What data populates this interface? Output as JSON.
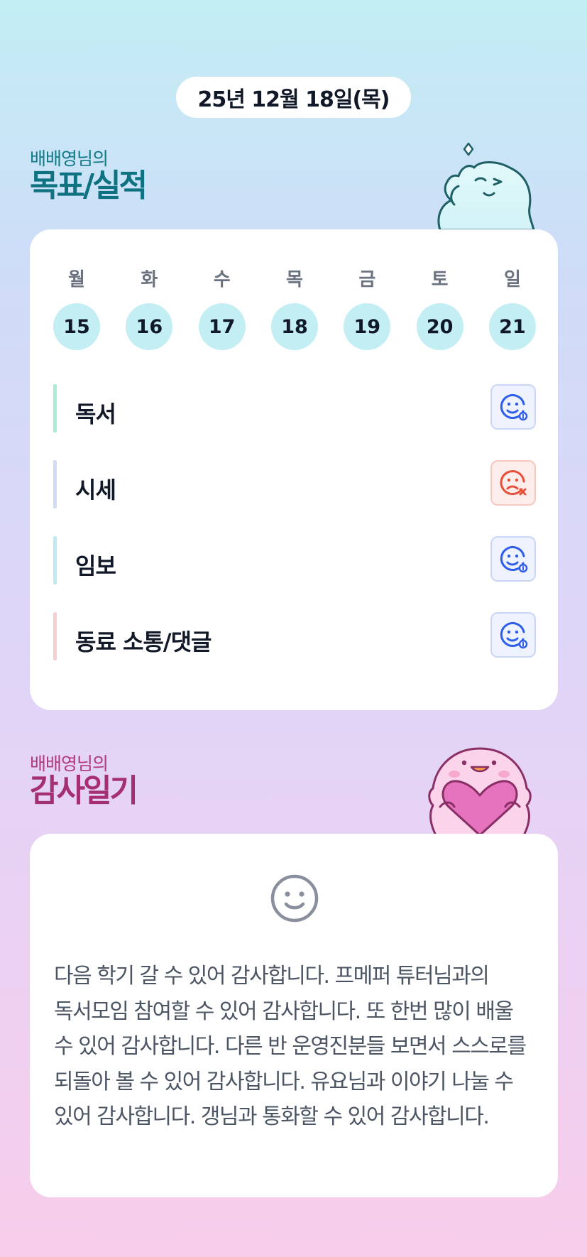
{
  "header": {
    "date": "25년 12월 18일(목)"
  },
  "goal_section": {
    "owner": "배배영님의",
    "title": "목표/실적",
    "week": [
      {
        "day": "월",
        "date": "15"
      },
      {
        "day": "화",
        "date": "16"
      },
      {
        "day": "수",
        "date": "17"
      },
      {
        "day": "목",
        "date": "18"
      },
      {
        "day": "금",
        "date": "19"
      },
      {
        "day": "토",
        "date": "20"
      },
      {
        "day": "일",
        "date": "21"
      }
    ],
    "goals": [
      {
        "label": "독서",
        "status": "done",
        "status_icon": "smile-check-icon",
        "bar_color": "#a8ecd6"
      },
      {
        "label": "시세",
        "status": "missed",
        "status_icon": "sad-x-icon",
        "bar_color": "#d3dcf6"
      },
      {
        "label": "임보",
        "status": "done",
        "status_icon": "smile-check-icon",
        "bar_color": "#bdebf1"
      },
      {
        "label": "동료 소통/댓글",
        "status": "done",
        "status_icon": "smile-check-icon",
        "bar_color": "#f9cfd2"
      }
    ]
  },
  "gratitude_section": {
    "owner": "배배영님의",
    "title": "감사일기",
    "mood_icon": "smile-face-icon",
    "text": "다음 학기 갈 수 있어 감사합니다. 프메퍼 튜터님과의 독서모임 참여할 수 있어 감사합니다. 또 한번 많이 배울 수 있어 감사합니다. 다른 반 운영진분들 보면서 스스로를 되돌아 볼 수 있어 감사합니다. 유요님과 이야기 나눌 수 있어 감사합니다. 갱님과 통화할 수 있어 감사합니다."
  },
  "colors": {
    "goal_title": "#0e7280",
    "gratitude_title": "#a42f72",
    "day_circle": "#c2eef4",
    "status_ok_icon": "#2f5fe8",
    "status_bad_icon": "#e8503a"
  }
}
